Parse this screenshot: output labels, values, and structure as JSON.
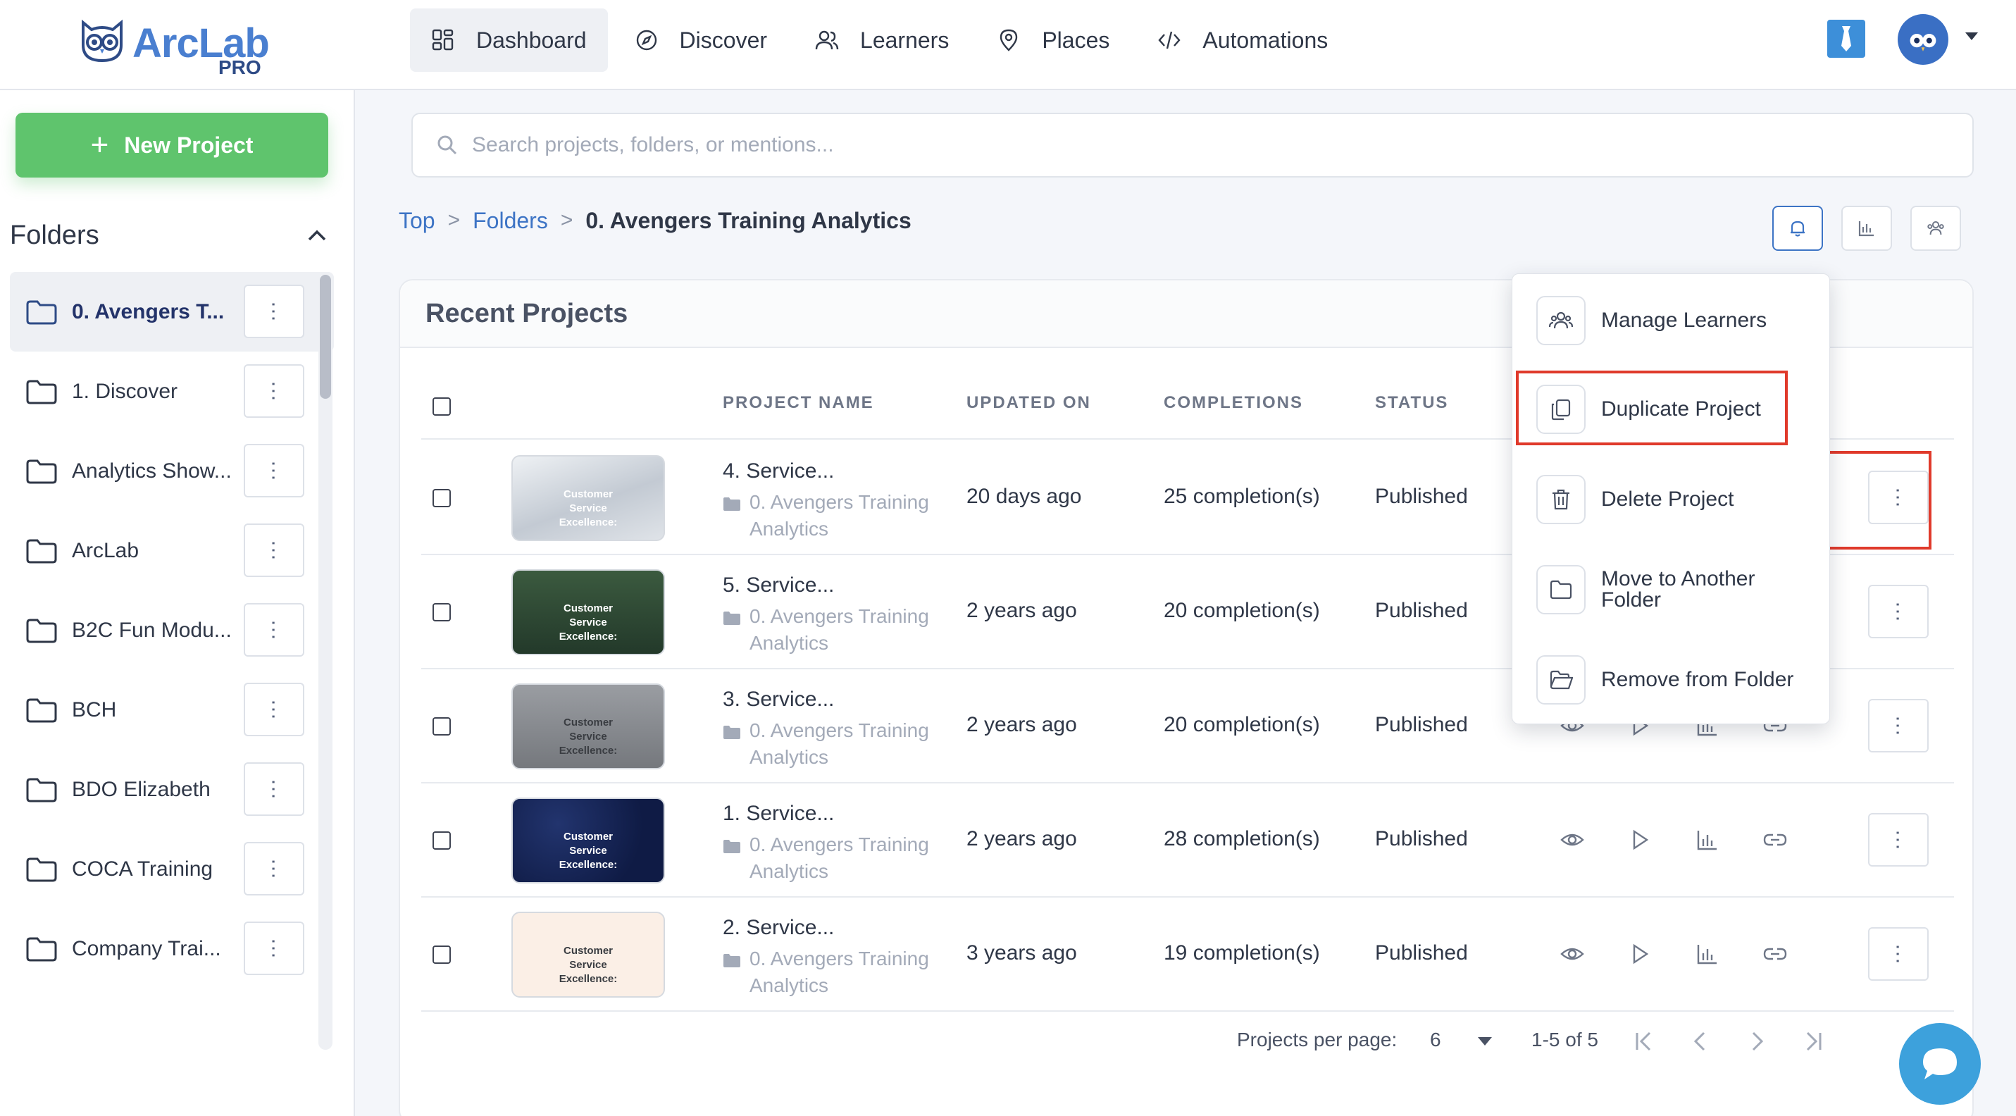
{
  "app": {
    "brand_text": "ArcLab",
    "brand_sub": "PRO"
  },
  "nav": {
    "items": [
      {
        "label": "Dashboard",
        "icon": "dashboard-icon",
        "active": true
      },
      {
        "label": "Discover",
        "icon": "compass-icon",
        "active": false
      },
      {
        "label": "Learners",
        "icon": "users-icon",
        "active": false
      },
      {
        "label": "Places",
        "icon": "map-pin-icon",
        "active": false
      },
      {
        "label": "Automations",
        "icon": "code-icon",
        "active": false
      }
    ]
  },
  "sidebar": {
    "new_project_label": "New Project",
    "folders_title": "Folders",
    "folders": [
      {
        "label": "0. Avengers T...",
        "selected": true
      },
      {
        "label": "1. Discover",
        "selected": false
      },
      {
        "label": "Analytics Show...",
        "selected": false
      },
      {
        "label": "ArcLab",
        "selected": false
      },
      {
        "label": "B2C Fun Modu...",
        "selected": false
      },
      {
        "label": "BCH",
        "selected": false
      },
      {
        "label": "BDO Elizabeth",
        "selected": false
      },
      {
        "label": "COCA Training",
        "selected": false
      },
      {
        "label": "Company Trai...",
        "selected": false
      }
    ]
  },
  "search": {
    "placeholder": "Search projects, folders, or mentions..."
  },
  "breadcrumb": {
    "items": [
      "Top",
      "Folders"
    ],
    "current": "0. Avengers Training Analytics"
  },
  "recent": {
    "title": "Recent Projects",
    "columns": [
      "PROJECT NAME",
      "UPDATED ON",
      "COMPLETIONS",
      "STATUS"
    ],
    "rows": [
      {
        "name": "4. Service...",
        "folder": "0. Avengers Training Analytics",
        "updated": "20 days ago",
        "completions": "25 completion(s)",
        "status": "Published",
        "thumb_caption": "Customer Service Excellence:",
        "thumb_color": "#c9ced6"
      },
      {
        "name": "5. Service...",
        "folder": "0. Avengers Training Analytics",
        "updated": "2 years ago",
        "completions": "20 completion(s)",
        "status": "Published",
        "thumb_caption": "Customer Service Excellence:",
        "thumb_color": "#2f4a33"
      },
      {
        "name": "3. Service...",
        "folder": "0. Avengers Training Analytics",
        "updated": "2 years ago",
        "completions": "20 completion(s)",
        "status": "Published",
        "thumb_caption": "Customer Service Excellence:",
        "thumb_color": "#8a8d92"
      },
      {
        "name": "1. Service...",
        "folder": "0. Avengers Training Analytics",
        "updated": "2 years ago",
        "completions": "28 completion(s)",
        "status": "Published",
        "thumb_caption": "Customer Service Excellence:",
        "thumb_color": "#14224f"
      },
      {
        "name": "2. Service...",
        "folder": "0. Avengers Training Analytics",
        "updated": "3 years ago",
        "completions": "19 completion(s)",
        "status": "Published",
        "thumb_caption": "Customer Service Excellence:",
        "thumb_color": "#fbeee4"
      }
    ]
  },
  "pagination": {
    "per_page_label": "Projects per page:",
    "per_page_value": "6",
    "range": "1-5 of 5"
  },
  "menu": {
    "items": [
      {
        "label": "Manage Learners",
        "icon": "users-icon"
      },
      {
        "label": "Duplicate Project",
        "icon": "copy-icon"
      },
      {
        "label": "Delete Project",
        "icon": "trash-icon"
      },
      {
        "label": "Move to Another Folder",
        "icon": "folder-icon"
      },
      {
        "label": "Remove from Folder",
        "icon": "folder-open-icon"
      }
    ]
  },
  "colors": {
    "accent": "#3d74c5",
    "new_project": "#5fc46d",
    "highlight": "#e03a2b"
  }
}
